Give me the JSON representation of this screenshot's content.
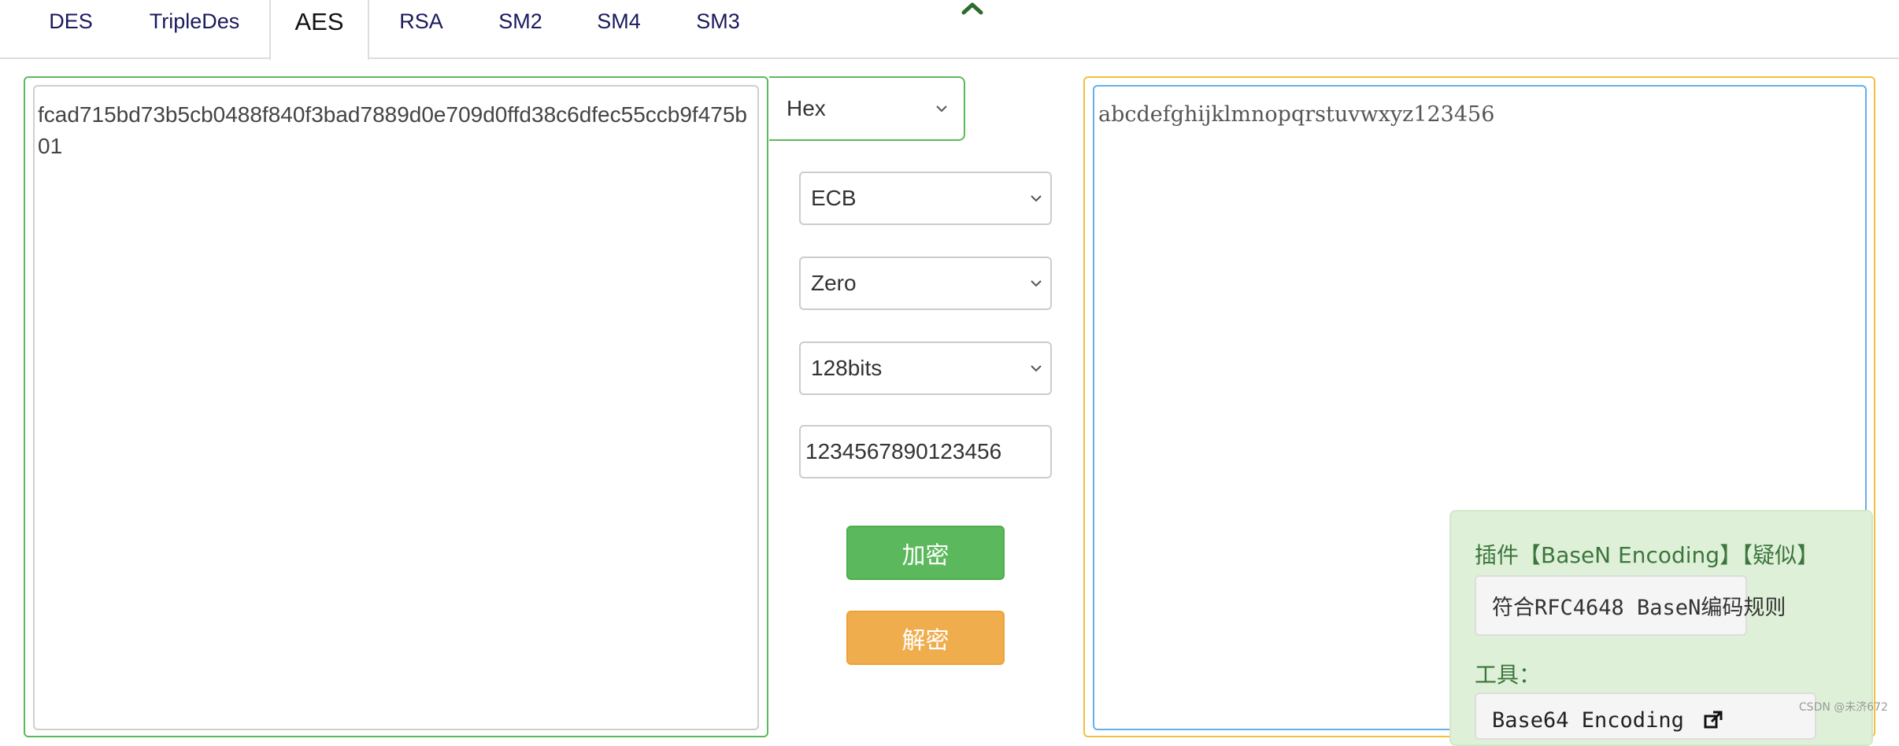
{
  "tabs": [
    {
      "label": "DES"
    },
    {
      "label": "TripleDes"
    },
    {
      "label": "AES"
    },
    {
      "label": "RSA"
    },
    {
      "label": "SM2"
    },
    {
      "label": "SM4"
    },
    {
      "label": "SM3"
    }
  ],
  "active_tab": "AES",
  "input_text": "fcad715bd73b5cb0488f840f3bad7889d0e709d0ffd38c6dfec55ccb9f475b01",
  "input_format": {
    "selected": "Hex"
  },
  "mode": {
    "selected": "ECB"
  },
  "padding": {
    "selected": "Zero"
  },
  "key_size": {
    "selected": "128bits"
  },
  "iv": {
    "value": "1234567890123456"
  },
  "buttons": {
    "encrypt": "加密",
    "decrypt": "解密"
  },
  "output_text": "abcdefghijklmnopqrstuvwxyz123456",
  "plugin": {
    "title": "插件【BaseN Encoding】【疑似】",
    "description": "符合RFC4648 BaseN编码规则",
    "tools_label": "工具：",
    "tool_link": "Base64 Encoding"
  },
  "watermark": "CSDN @未济672",
  "colors": {
    "success": "#5cb85c",
    "warning": "#f0ad4e",
    "focus": "#66afe9",
    "plugin_bg": "#dff0d8",
    "plugin_text": "#3c763d"
  },
  "icons": [
    "chevron-up-icon",
    "chevron-down-icon",
    "external-link-icon"
  ]
}
